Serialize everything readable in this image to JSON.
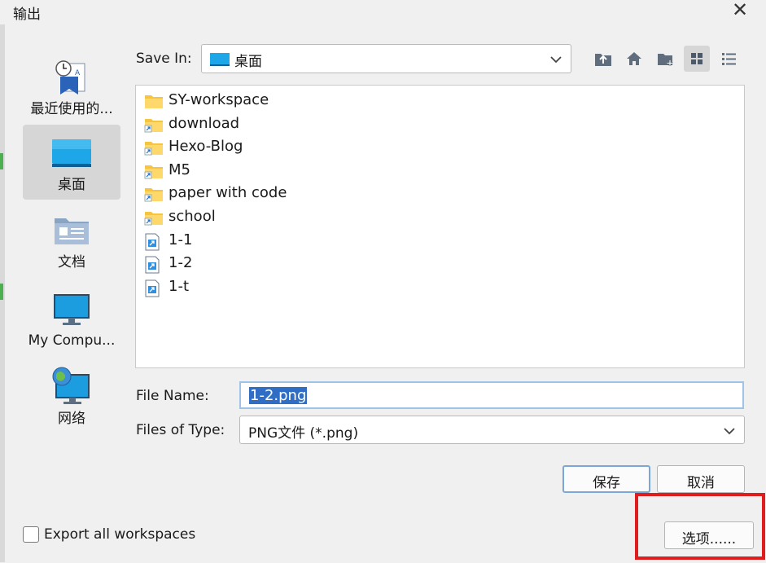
{
  "window": {
    "title": "输出",
    "close_glyph": "✕"
  },
  "sidebar": {
    "items": [
      {
        "label": "最近使用的...",
        "icon": "recent-items-icon"
      },
      {
        "label": "桌面",
        "icon": "desktop-icon",
        "selected": true
      },
      {
        "label": "文档",
        "icon": "documents-icon"
      },
      {
        "label": "My Compu...",
        "icon": "computer-icon"
      },
      {
        "label": "网络",
        "icon": "network-icon"
      }
    ]
  },
  "save_in": {
    "label": "Save In:",
    "value": "桌面"
  },
  "toolbar": {
    "buttons": [
      "up-folder-icon",
      "home-icon",
      "new-folder-icon",
      "grid-view-icon",
      "list-view-icon"
    ],
    "selected": "grid-view-icon"
  },
  "files": [
    {
      "name": "SY-workspace",
      "type": "folder"
    },
    {
      "name": "download",
      "type": "folder-shortcut"
    },
    {
      "name": "Hexo-Blog",
      "type": "folder-shortcut"
    },
    {
      "name": "M5",
      "type": "folder-shortcut"
    },
    {
      "name": "paper with code",
      "type": "folder-shortcut"
    },
    {
      "name": "school",
      "type": "folder-shortcut"
    },
    {
      "name": "1-1",
      "type": "file-shortcut"
    },
    {
      "name": "1-2",
      "type": "file-shortcut"
    },
    {
      "name": "1-t",
      "type": "file-shortcut"
    }
  ],
  "file_name": {
    "label": "File Name:",
    "value": "1-2.png"
  },
  "file_type": {
    "label": "Files of Type:",
    "value": "PNG文件 (*.png)"
  },
  "buttons": {
    "save": "保存",
    "cancel": "取消",
    "options": "选项......"
  },
  "export_all": {
    "label": "Export all workspaces",
    "checked": false
  },
  "colors": {
    "selection": "#2f6ec4",
    "highlight_box": "#e01c1c",
    "folder": "#f5c542"
  }
}
